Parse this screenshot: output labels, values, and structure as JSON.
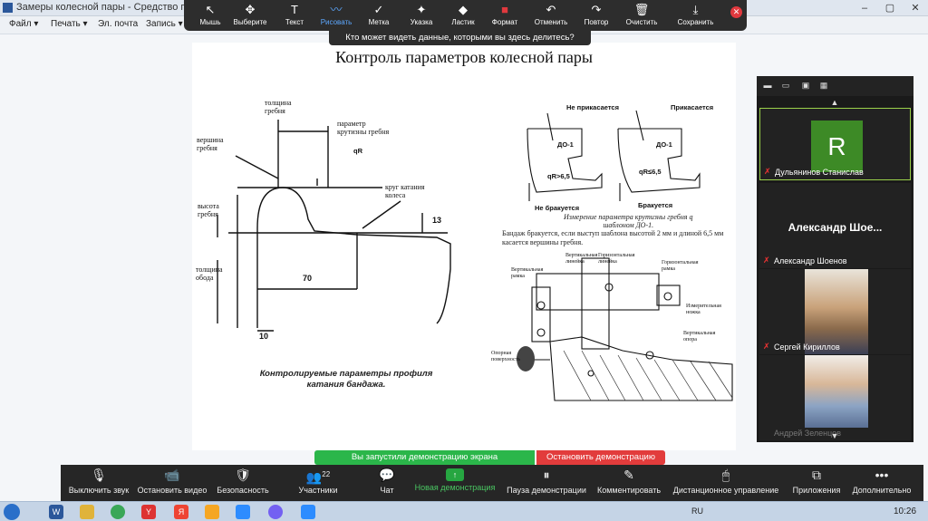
{
  "window": {
    "title": "Замеры колесной пары - Средство просмот",
    "win_icons": [
      "–",
      "▢",
      "✕"
    ]
  },
  "menu": [
    "Файл ▾",
    "Печать ▾",
    "Эл. почта",
    "Запись ▾"
  ],
  "annotation_toolbar": {
    "tools": [
      {
        "label": "Мышь",
        "icon": "↖"
      },
      {
        "label": "Выберите",
        "icon": "✥"
      },
      {
        "label": "Текст",
        "icon": "T"
      },
      {
        "label": "Рисовать",
        "icon": "〰"
      },
      {
        "label": "Метка",
        "icon": "✓"
      },
      {
        "label": "Указка",
        "icon": "✦"
      },
      {
        "label": "Ластик",
        "icon": "◆"
      },
      {
        "label": "Формат",
        "icon": "■"
      },
      {
        "label": "Отменить",
        "icon": "↶"
      },
      {
        "label": "Повтор",
        "icon": "↷"
      },
      {
        "label": "Очистить",
        "icon": "🗑"
      },
      {
        "label": "Сохранить",
        "icon": "⤓"
      }
    ],
    "close": "✕",
    "share_tip": "Кто может видеть данные, которыми вы здесь делитесь?"
  },
  "document": {
    "title": "Контроль параметров колесной пары",
    "labels": {
      "flange_thickness": "толщина\nгребня",
      "steepness_param": "параметр\nкрутизны гребня",
      "q_r": "qR",
      "flange_top": "вершина\nгребня",
      "rolling_circle": "круг катания\nколеса",
      "flange_height": "высота\nгребня",
      "rim_thickness": "толщина\nобода",
      "dim_70": "70",
      "dim_13": "13",
      "dim_10": "10",
      "not_touching": "Не прикасается",
      "touching": "Прикасается",
      "do1": "ДО-1",
      "q_gt": "qR>6,5",
      "q_le": "qR≤6,5",
      "not_reject": "Не бракуется",
      "reject": "Бракуется",
      "horiz_ruler": "Горизонтальная\nлинейка",
      "vert_ruler": "Вертикальная\nлинейка",
      "horiz_frame1": "Горизонтальная\nрамка",
      "horiz_frame2": "Горизонтальная\nрамка",
      "vert_frame": "Вертикальная\nрамка",
      "meas_leg": "Измерительная\nножка",
      "vert_support": "Вертикальная\nопора",
      "support_surface": "Опорная\nповерхность"
    },
    "caption": "Контролируемые параметры профиля катания бандажа.",
    "measure_caption": "Измерение параметра крутизны гребня q\nшаблоном ДО-1.",
    "note": "Бандаж бракуется, если выступ шаблона высотой 2 мм и длиной 6,5 мм касается вершины гребня."
  },
  "gallery": {
    "view_buttons": [
      "▬",
      "▭",
      "▣",
      "▦"
    ],
    "participants": [
      {
        "name": "Дульянинов Станислав",
        "avatar": "R"
      },
      {
        "name": "Александр Шоенов",
        "display": "Александр  Шое..."
      },
      {
        "name": "Сергей Кириллов"
      },
      {
        "name": "Андрей Зеленцов"
      }
    ],
    "scroll_up": "▲",
    "scroll_down": "▼"
  },
  "share_status": {
    "running": "Вы запустили демонстрацию экрана",
    "stop": "Остановить демонстрацию"
  },
  "zoom_toolbar": [
    {
      "label": "Выключить звук",
      "icon": "🎙"
    },
    {
      "label": "Остановить видео",
      "icon": "📹"
    },
    {
      "label": "Безопасность",
      "icon": "🛡"
    },
    {
      "label": "Участники",
      "icon": "👥",
      "count": "22"
    },
    {
      "label": "Чат",
      "icon": "💬"
    },
    {
      "label": "Новая демонстрация",
      "icon": "↑"
    },
    {
      "label": "Пауза демонстрации",
      "icon": "⏸"
    },
    {
      "label": "Комментировать",
      "icon": "✎"
    },
    {
      "label": "Дистанционное управление",
      "icon": "🖱"
    },
    {
      "label": "Приложения",
      "icon": "⧉"
    },
    {
      "label": "Дополнительно",
      "icon": "•••"
    }
  ],
  "taskbar": {
    "lang": "RU",
    "time": "10:26"
  }
}
